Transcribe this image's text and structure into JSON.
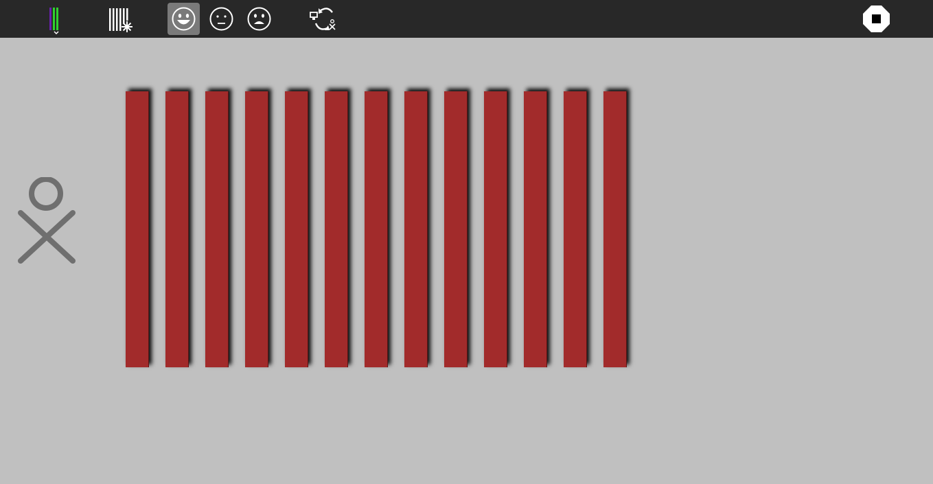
{
  "toolbar": {
    "buttons": [
      {
        "id": "activity-button",
        "icon": "colored-bars-icon",
        "active": false
      },
      {
        "id": "tally-button",
        "icon": "tally-sparkle-icon",
        "active": false
      },
      {
        "id": "happy-button",
        "icon": "happy-face-icon",
        "active": true
      },
      {
        "id": "neutral-button",
        "icon": "neutral-face-icon",
        "active": false
      },
      {
        "id": "sad-button",
        "icon": "sad-face-icon",
        "active": false
      },
      {
        "id": "share-button",
        "icon": "share-sync-icon",
        "active": false
      },
      {
        "id": "stop-button",
        "icon": "stop-icon",
        "active": false
      }
    ],
    "background_color": "#282828",
    "active_color": "#7a7a7a"
  },
  "canvas": {
    "background_color": "#c0c0c0",
    "bar_color": "#a22b2b",
    "bar_count": 13,
    "xo_icon": "xo-person-icon"
  }
}
